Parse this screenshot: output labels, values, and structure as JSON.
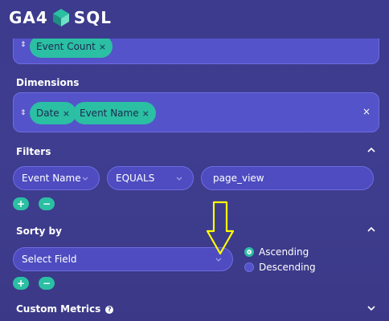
{
  "app": {
    "brand_left": "GA4",
    "brand_right": "SQL"
  },
  "metrics": {
    "chips": [
      {
        "label": "Event Count"
      }
    ]
  },
  "dimensions": {
    "label": "Dimensions",
    "chips": [
      {
        "label": "Date"
      },
      {
        "label": "Event Name"
      }
    ]
  },
  "filters": {
    "label": "Filters",
    "field": "Event Name",
    "operator": "EQUALS",
    "value": "page_view"
  },
  "sort": {
    "label": "Sorty by",
    "field_placeholder": "Select Field",
    "options": [
      {
        "label": "Ascending",
        "selected": true
      },
      {
        "label": "Descending",
        "selected": false
      }
    ]
  },
  "custom_metrics": {
    "label": "Custom Metrics"
  },
  "buttons": {
    "plus": "+",
    "minus": "−",
    "remove": "×"
  },
  "colors": {
    "accent": "#2bbfa3",
    "annotation": "#ffff00",
    "background": "#3c3b8d"
  }
}
